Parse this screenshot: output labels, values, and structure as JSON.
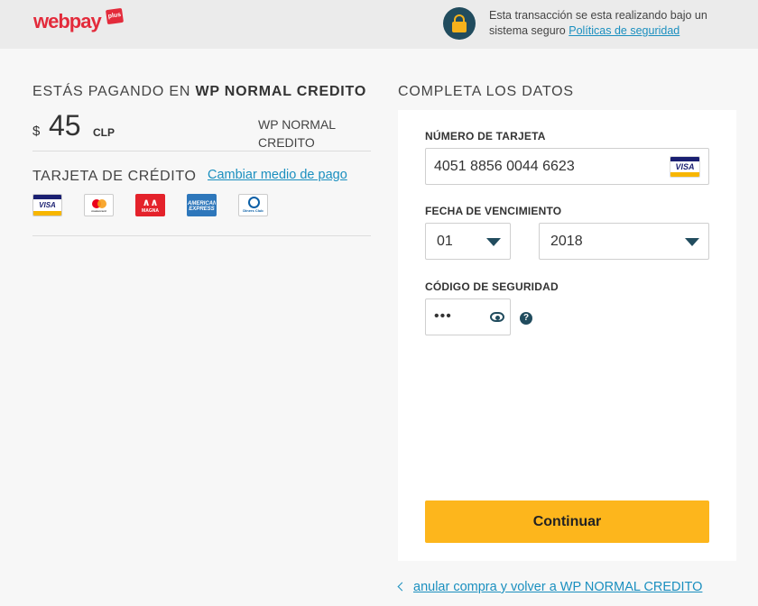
{
  "header": {
    "logo_main": "webpay",
    "logo_badge": "plus",
    "secure_text": "Esta transacción se esta realizando bajo un sistema seguro",
    "policies_link": "Políticas de seguridad"
  },
  "summary": {
    "title_prefix": "ESTÁS PAGANDO EN",
    "title_merchant": "WP NORMAL CREDITO",
    "currency_symbol": "$",
    "amount": "45",
    "currency_code": "CLP",
    "merchant_line1": "WP NORMAL",
    "merchant_line2": "CREDITO"
  },
  "payment_method": {
    "label": "TARJETA DE CRÉDITO",
    "change_link": "Cambiar medio de pago",
    "brands": [
      {
        "name": "VISA",
        "icon": "visa-logo"
      },
      {
        "name": "mastercard",
        "icon": "mastercard-logo"
      },
      {
        "name": "MAGNA",
        "icon": "magna-logo"
      },
      {
        "name": "AMERICAN EXPRESS",
        "icon": "amex-logo"
      },
      {
        "name": "Diners Club",
        "icon": "diners-logo"
      }
    ]
  },
  "form": {
    "title": "COMPLETA LOS DATOS",
    "card_number_label": "NÚMERO DE TARJETA",
    "card_number_value": "4051 8856 0044 6623",
    "card_brand_badge": "VISA",
    "expiry_label": "FECHA DE VENCIMIENTO",
    "expiry_month": "01",
    "expiry_year": "2018",
    "cvv_label": "CÓDIGO DE SEGURIDAD",
    "cvv_value": "•••",
    "help_glyph": "?",
    "submit_label": "Continuar"
  },
  "footer": {
    "cancel_link": "anular compra y volver a WP NORMAL CREDITO"
  },
  "colors": {
    "accent_button": "#fdb61c",
    "link": "#1a8fbf",
    "dark_teal": "#214c5e",
    "brand_red": "#e32b3b"
  }
}
